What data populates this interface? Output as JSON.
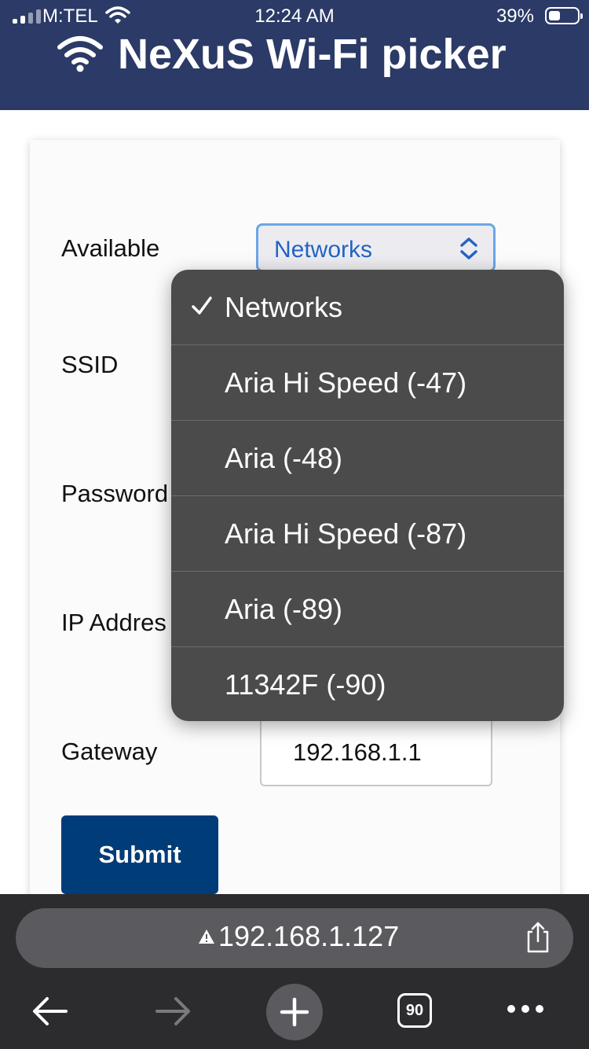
{
  "status_bar": {
    "carrier": "M:TEL",
    "time": "12:24 AM",
    "battery": "39%"
  },
  "header": {
    "title": "NeXuS Wi-Fi picker"
  },
  "form": {
    "available_label": "Available",
    "ssid_label": "SSID",
    "password_label": "Password",
    "ip_label": "IP Addres",
    "gateway_label": "Gateway",
    "gateway_value": "192.168.1.1",
    "select_value": "Networks",
    "submit_label": "Submit"
  },
  "dropdown": {
    "selected_index": 0,
    "options": [
      "Networks",
      "Aria Hi Speed (-47)",
      "Aria (-48)",
      "Aria Hi Speed (-87)",
      "Aria (-89)",
      "11342F (-90)"
    ]
  },
  "browser": {
    "url": "192.168.1.127",
    "tab_count": "90"
  },
  "colors": {
    "header_bg": "#2b3a66",
    "submit_bg": "#003c78",
    "dropdown_bg": "#4b4b4b",
    "select_border": "#6aa6e8",
    "select_text": "#2463c3",
    "browser_bar": "#2c2c2e"
  },
  "icons": [
    "signal-icon",
    "wifi-icon",
    "battery-icon",
    "chevron-updown-icon",
    "checkmark-icon",
    "warning-icon",
    "share-icon",
    "back-arrow-icon",
    "forward-arrow-icon",
    "plus-icon",
    "more-icon"
  ]
}
